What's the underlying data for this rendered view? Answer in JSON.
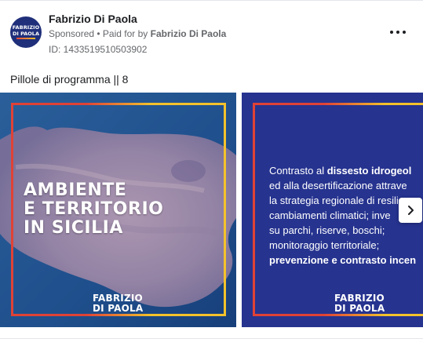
{
  "ad": {
    "page_name": "Fabrizio Di Paola",
    "sponsored_label": "Sponsored",
    "separator": " • ",
    "paid_for_prefix": "Paid for by ",
    "paid_for_name": "Fabrizio Di Paola",
    "ad_id": "ID: 1433519510503902",
    "avatar_line1": "FABRIZIO",
    "avatar_line2": "DI PAOLA",
    "more_icon": "more-horizontal-icon",
    "caption": "Pillole di programma || 8"
  },
  "carousel": {
    "slides": [
      {
        "headline": [
          "AMBIENTE",
          "E TERRITORIO",
          "IN SICILIA"
        ],
        "brand_line1": "FABRIZIO",
        "brand_line2": "DI PAOLA"
      },
      {
        "text_segments": [
          [
            "Contrasto al ",
            "dissesto idrogeol"
          ],
          [
            "ed alla desertificazione attrave",
            ""
          ],
          [
            "la strategia regionale di resilien",
            ""
          ],
          [
            "cambiamenti climatici; inve",
            ""
          ],
          [
            "su parchi, riserve, boschi;",
            ""
          ],
          [
            "monitoraggio territoriale;",
            ""
          ],
          [
            "",
            "prevenzione e contrasto incen"
          ]
        ],
        "brand_line1": "FABRIZIO",
        "brand_line2": "DI PAOLA"
      }
    ],
    "next_icon": "chevron-right-icon"
  },
  "colors": {
    "brand_blue": "#26338f",
    "accent_red": "#e04236",
    "accent_yellow": "#f4c22b",
    "text_secondary": "#65676b"
  }
}
